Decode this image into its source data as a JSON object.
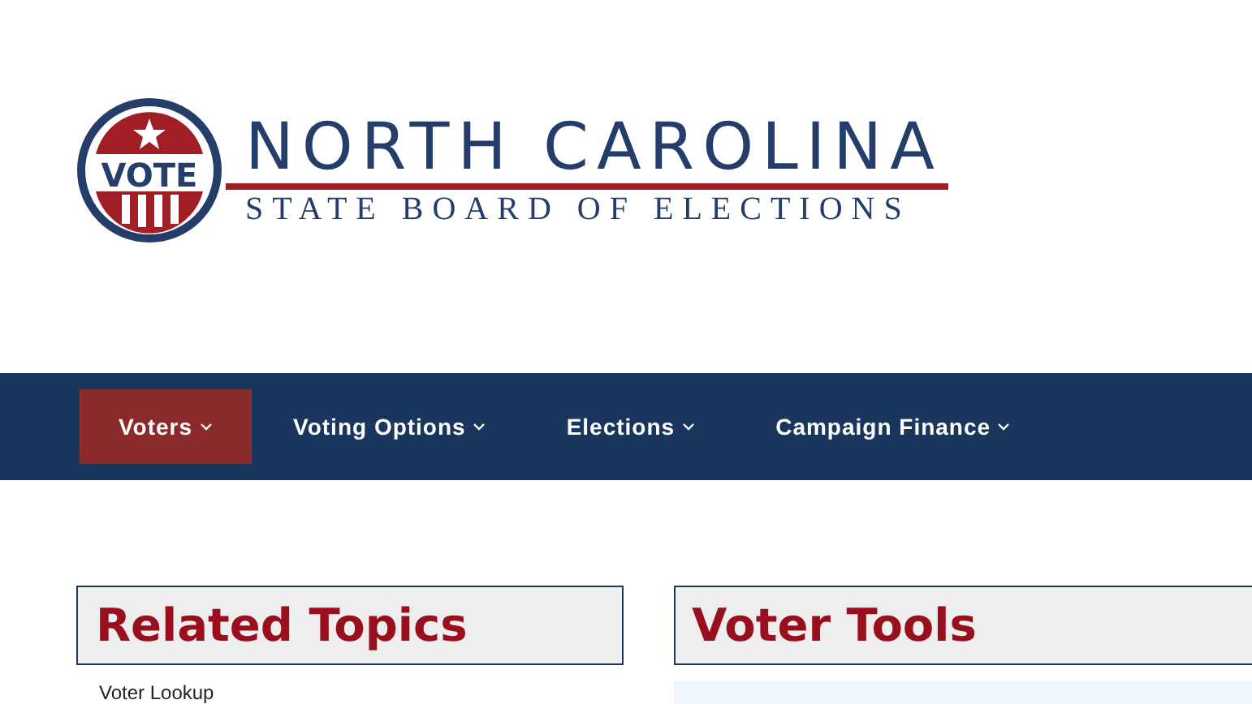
{
  "logo": {
    "badge": "VOTE",
    "title": "NORTH CAROLINA",
    "subtitle": "STATE BOARD OF ELECTIONS"
  },
  "nav": [
    {
      "label": "Voters",
      "selected": true
    },
    {
      "label": "Voting Options",
      "selected": false
    },
    {
      "label": "Elections",
      "selected": false
    },
    {
      "label": "Campaign Finance",
      "selected": false
    }
  ],
  "related_topics": {
    "title": "Related Topics",
    "items": [
      "Voter Lookup"
    ]
  },
  "voter_tools": {
    "title": "Voter Tools"
  }
}
